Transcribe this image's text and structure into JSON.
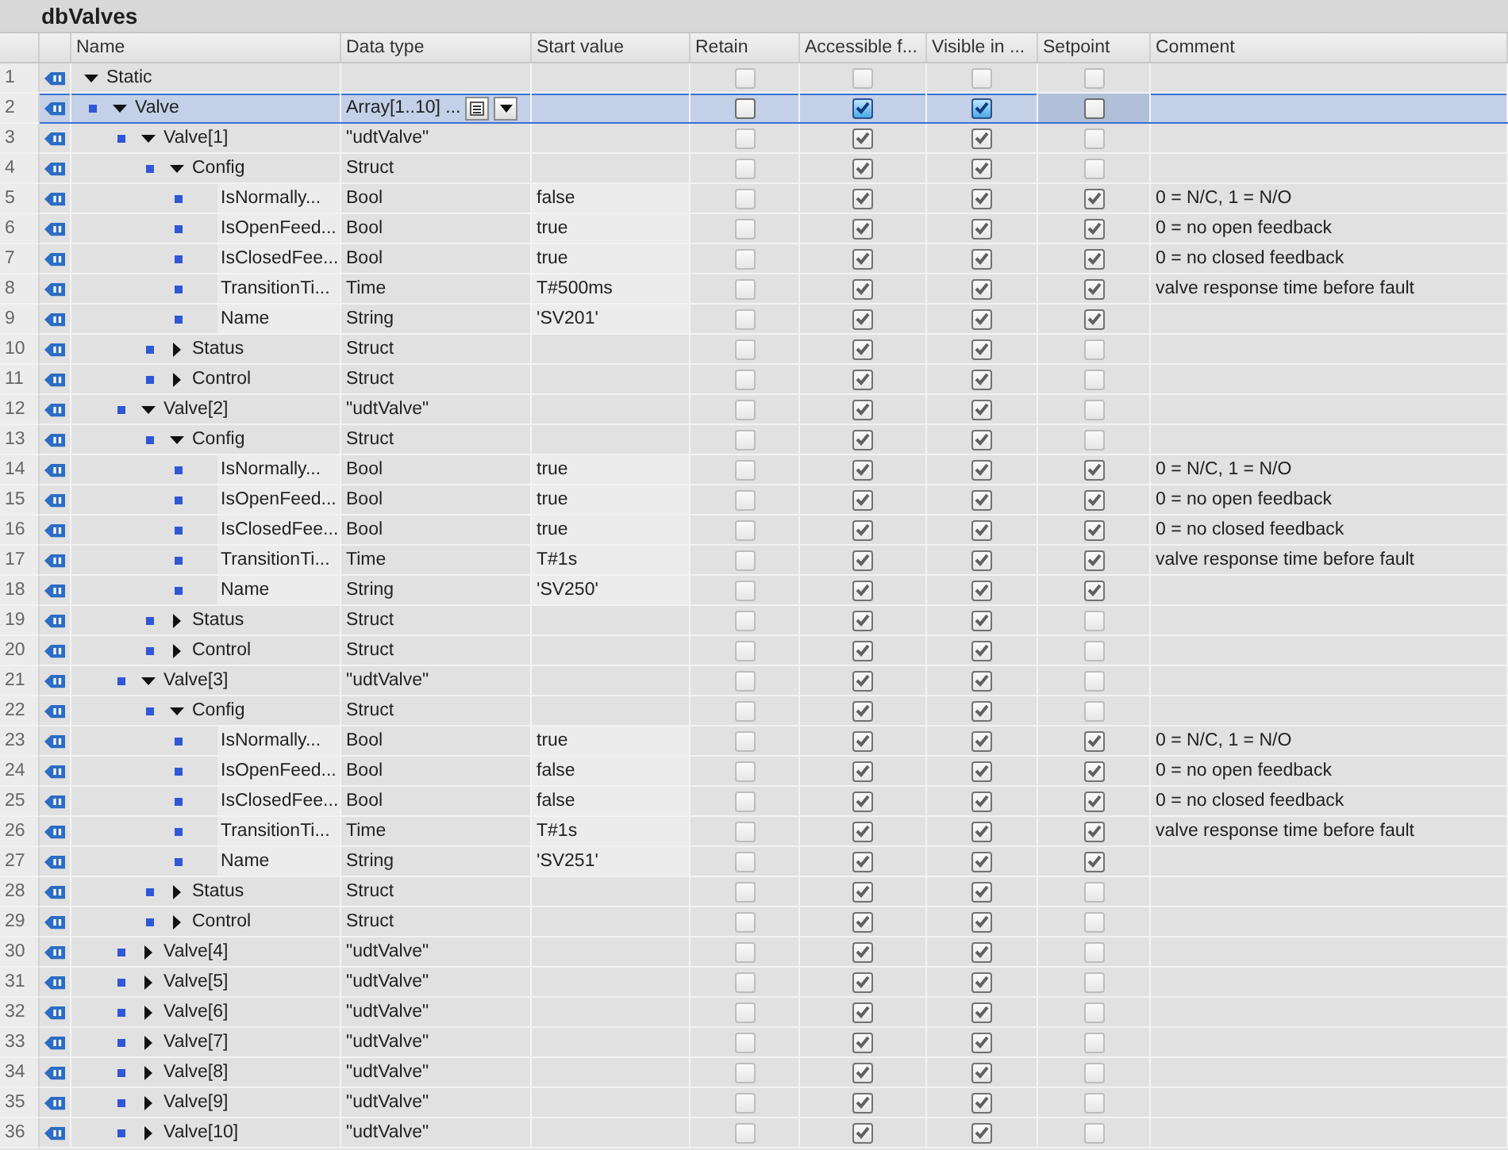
{
  "title": "dbValves",
  "columns": [
    "Name",
    "Data type",
    "Start value",
    "Retain",
    "Accessible f...",
    "Visible in ...",
    "Setpoint",
    "Comment"
  ],
  "rows": [
    {
      "number": "1",
      "name": "Static",
      "expanded": true,
      "retain": false,
      "accessible": false,
      "visible": false,
      "setpoint": false,
      "selected": false,
      "children": [
        {
          "number": "2",
          "name": "Valve",
          "type": "Array[1..10] ...",
          "expanded": true,
          "retain": false,
          "accessible": true,
          "visible": true,
          "setpoint": false,
          "selected": true,
          "children": [
            {
              "number": "3",
              "name": "Valve[1]",
              "type": "\"udtValve\"",
              "expanded": true,
              "retain": false,
              "accessible": true,
              "visible": true,
              "setpoint": false,
              "selected": false,
              "children": [
                {
                  "number": "4",
                  "name": "Config",
                  "type": "Struct",
                  "expanded": true,
                  "retain": false,
                  "accessible": true,
                  "visible": true,
                  "setpoint": false,
                  "selected": false,
                  "children": [
                    {
                      "number": "5",
                      "name": "IsNormally...",
                      "type": "Bool",
                      "start": "false",
                      "retain": false,
                      "accessible": true,
                      "visible": true,
                      "setpoint": true,
                      "comment": "0 = N/C, 1 = N/O",
                      "selected": false
                    },
                    {
                      "number": "6",
                      "name": "IsOpenFeed...",
                      "type": "Bool",
                      "start": "true",
                      "retain": false,
                      "accessible": true,
                      "visible": true,
                      "setpoint": true,
                      "comment": "0 = no open feedback",
                      "selected": false
                    },
                    {
                      "number": "7",
                      "name": "IsClosedFee...",
                      "type": "Bool",
                      "start": "true",
                      "retain": false,
                      "accessible": true,
                      "visible": true,
                      "setpoint": true,
                      "comment": "0 = no closed feedback",
                      "selected": false
                    },
                    {
                      "number": "8",
                      "name": "TransitionTi...",
                      "type": "Time",
                      "start": "T#500ms",
                      "retain": false,
                      "accessible": true,
                      "visible": true,
                      "setpoint": true,
                      "comment": "valve response time before fault",
                      "selected": false
                    },
                    {
                      "number": "9",
                      "name": "Name",
                      "type": "String",
                      "start": "'SV201'",
                      "retain": false,
                      "accessible": true,
                      "visible": true,
                      "setpoint": true,
                      "selected": false
                    }
                  ]
                },
                {
                  "number": "10",
                  "name": "Status",
                  "type": "Struct",
                  "expanded": false,
                  "retain": false,
                  "accessible": true,
                  "visible": true,
                  "setpoint": false,
                  "selected": false
                },
                {
                  "number": "11",
                  "name": "Control",
                  "type": "Struct",
                  "expanded": false,
                  "retain": false,
                  "accessible": true,
                  "visible": true,
                  "setpoint": false,
                  "selected": false
                }
              ]
            },
            {
              "number": "12",
              "name": "Valve[2]",
              "type": "\"udtValve\"",
              "expanded": true,
              "retain": false,
              "accessible": true,
              "visible": true,
              "setpoint": false,
              "selected": false,
              "children": [
                {
                  "number": "13",
                  "name": "Config",
                  "type": "Struct",
                  "expanded": true,
                  "retain": false,
                  "accessible": true,
                  "visible": true,
                  "setpoint": false,
                  "selected": false,
                  "children": [
                    {
                      "number": "14",
                      "name": "IsNormally...",
                      "type": "Bool",
                      "start": "true",
                      "retain": false,
                      "accessible": true,
                      "visible": true,
                      "setpoint": true,
                      "comment": "0 = N/C, 1 = N/O",
                      "selected": false
                    },
                    {
                      "number": "15",
                      "name": "IsOpenFeed...",
                      "type": "Bool",
                      "start": "true",
                      "retain": false,
                      "accessible": true,
                      "visible": true,
                      "setpoint": true,
                      "comment": "0 = no open feedback",
                      "selected": false
                    },
                    {
                      "number": "16",
                      "name": "IsClosedFee...",
                      "type": "Bool",
                      "start": "true",
                      "retain": false,
                      "accessible": true,
                      "visible": true,
                      "setpoint": true,
                      "comment": "0 = no closed feedback",
                      "selected": false
                    },
                    {
                      "number": "17",
                      "name": "TransitionTi...",
                      "type": "Time",
                      "start": "T#1s",
                      "retain": false,
                      "accessible": true,
                      "visible": true,
                      "setpoint": true,
                      "comment": "valve response time before fault",
                      "selected": false
                    },
                    {
                      "number": "18",
                      "name": "Name",
                      "type": "String",
                      "start": "'SV250'",
                      "retain": false,
                      "accessible": true,
                      "visible": true,
                      "setpoint": true,
                      "selected": false
                    }
                  ]
                },
                {
                  "number": "19",
                  "name": "Status",
                  "type": "Struct",
                  "expanded": false,
                  "retain": false,
                  "accessible": true,
                  "visible": true,
                  "setpoint": false,
                  "selected": false
                },
                {
                  "number": "20",
                  "name": "Control",
                  "type": "Struct",
                  "expanded": false,
                  "retain": false,
                  "accessible": true,
                  "visible": true,
                  "setpoint": false,
                  "selected": false
                }
              ]
            },
            {
              "number": "21",
              "name": "Valve[3]",
              "type": "\"udtValve\"",
              "expanded": true,
              "retain": false,
              "accessible": true,
              "visible": true,
              "setpoint": false,
              "selected": false,
              "children": [
                {
                  "number": "22",
                  "name": "Config",
                  "type": "Struct",
                  "expanded": true,
                  "retain": false,
                  "accessible": true,
                  "visible": true,
                  "setpoint": false,
                  "selected": false,
                  "children": [
                    {
                      "number": "23",
                      "name": "IsNormally...",
                      "type": "Bool",
                      "start": "true",
                      "retain": false,
                      "accessible": true,
                      "visible": true,
                      "setpoint": true,
                      "comment": "0 = N/C, 1 = N/O",
                      "selected": false
                    },
                    {
                      "number": "24",
                      "name": "IsOpenFeed...",
                      "type": "Bool",
                      "start": "false",
                      "retain": false,
                      "accessible": true,
                      "visible": true,
                      "setpoint": true,
                      "comment": "0 = no open feedback",
                      "selected": false
                    },
                    {
                      "number": "25",
                      "name": "IsClosedFee...",
                      "type": "Bool",
                      "start": "false",
                      "retain": false,
                      "accessible": true,
                      "visible": true,
                      "setpoint": true,
                      "comment": "0 = no closed feedback",
                      "selected": false
                    },
                    {
                      "number": "26",
                      "name": "TransitionTi...",
                      "type": "Time",
                      "start": "T#1s",
                      "retain": false,
                      "accessible": true,
                      "visible": true,
                      "setpoint": true,
                      "comment": "valve response time before fault",
                      "selected": false
                    },
                    {
                      "number": "27",
                      "name": "Name",
                      "type": "String",
                      "start": "'SV251'",
                      "retain": false,
                      "accessible": true,
                      "visible": true,
                      "setpoint": true,
                      "selected": false
                    }
                  ]
                },
                {
                  "number": "28",
                  "name": "Status",
                  "type": "Struct",
                  "expanded": false,
                  "retain": false,
                  "accessible": true,
                  "visible": true,
                  "setpoint": false,
                  "selected": false
                },
                {
                  "number": "29",
                  "name": "Control",
                  "type": "Struct",
                  "expanded": false,
                  "retain": false,
                  "accessible": true,
                  "visible": true,
                  "setpoint": false,
                  "selected": false
                }
              ]
            },
            {
              "number": "30",
              "name": "Valve[4]",
              "type": "\"udtValve\"",
              "expanded": false,
              "retain": false,
              "accessible": true,
              "visible": true,
              "setpoint": false,
              "selected": false
            },
            {
              "number": "31",
              "name": "Valve[5]",
              "type": "\"udtValve\"",
              "expanded": false,
              "retain": false,
              "accessible": true,
              "visible": true,
              "setpoint": false,
              "selected": false
            },
            {
              "number": "32",
              "name": "Valve[6]",
              "type": "\"udtValve\"",
              "expanded": false,
              "retain": false,
              "accessible": true,
              "visible": true,
              "setpoint": false,
              "selected": false
            },
            {
              "number": "33",
              "name": "Valve[7]",
              "type": "\"udtValve\"",
              "expanded": false,
              "retain": false,
              "accessible": true,
              "visible": true,
              "setpoint": false,
              "selected": false
            },
            {
              "number": "34",
              "name": "Valve[8]",
              "type": "\"udtValve\"",
              "expanded": false,
              "retain": false,
              "accessible": true,
              "visible": true,
              "setpoint": false,
              "selected": false
            },
            {
              "number": "35",
              "name": "Valve[9]",
              "type": "\"udtValve\"",
              "expanded": false,
              "retain": false,
              "accessible": true,
              "visible": true,
              "setpoint": false,
              "selected": false
            },
            {
              "number": "36",
              "name": "Valve[10]",
              "type": "\"udtValve\"",
              "expanded": false,
              "retain": false,
              "accessible": true,
              "visible": true,
              "setpoint": false,
              "selected": false
            }
          ]
        }
      ]
    }
  ]
}
